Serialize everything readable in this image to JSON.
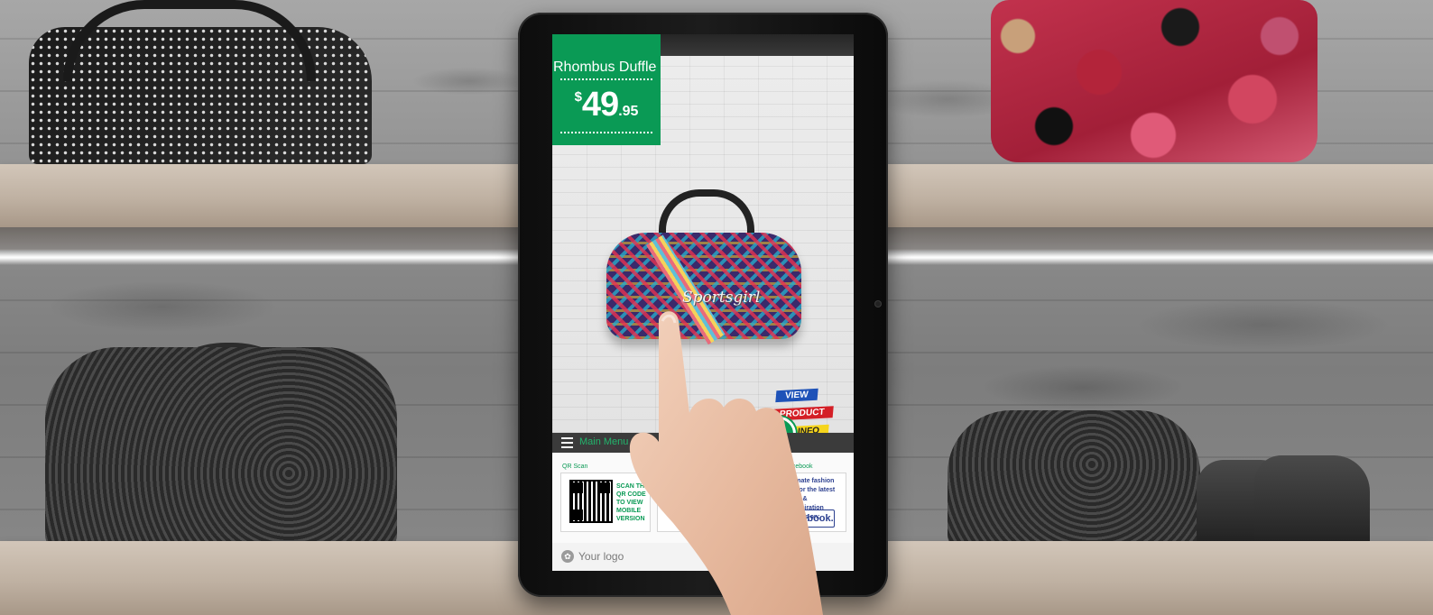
{
  "kiosk": {
    "product_name": "Rhombus Duffle",
    "price": {
      "currency": "$",
      "whole": "49",
      "cents": ".95"
    },
    "product_logo_text": "Sportsgirl",
    "cta": {
      "line1": "VIEW",
      "line2": "PRODUCT",
      "line3": "INFO"
    },
    "menu": {
      "label": "Main Menu"
    },
    "cards": {
      "qr": {
        "title": "QR Scan",
        "text_lines": [
          "SCAN THE",
          "QR CODE",
          "TO VIEW",
          "MOBILE",
          "VERSION"
        ]
      },
      "facebook": {
        "title": "acebook",
        "text_lines": [
          "timate fashion",
          "n for the latest",
          "ing & inspiration",
          "nd us on:"
        ],
        "button": "acebook."
      }
    },
    "footer": {
      "logo_text": "Your logo"
    }
  },
  "colors": {
    "accent_green": "#0a9a55",
    "menu_bar": "#3b3b3b",
    "facebook_blue": "#2b3f8f"
  }
}
